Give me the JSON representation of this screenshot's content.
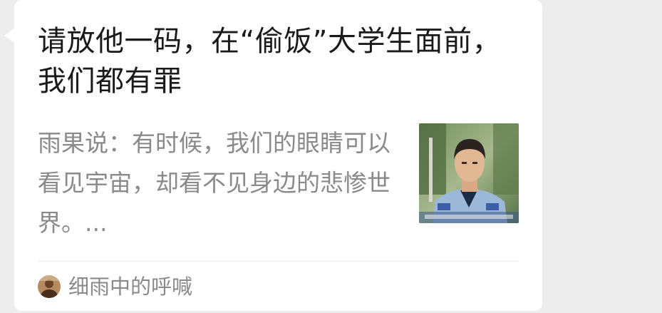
{
  "article": {
    "title": "请放他一码，在“偷饭”大学生面前，我们都有罪",
    "summary": "雨果说：有时候，我们的眼睛可以看见宇宙，却看不见身边的悲惨世界。...",
    "thumbnail_icon": "photo-of-police-officer"
  },
  "source": {
    "name": "细雨中的呼喊",
    "avatar_icon": "account-avatar"
  }
}
